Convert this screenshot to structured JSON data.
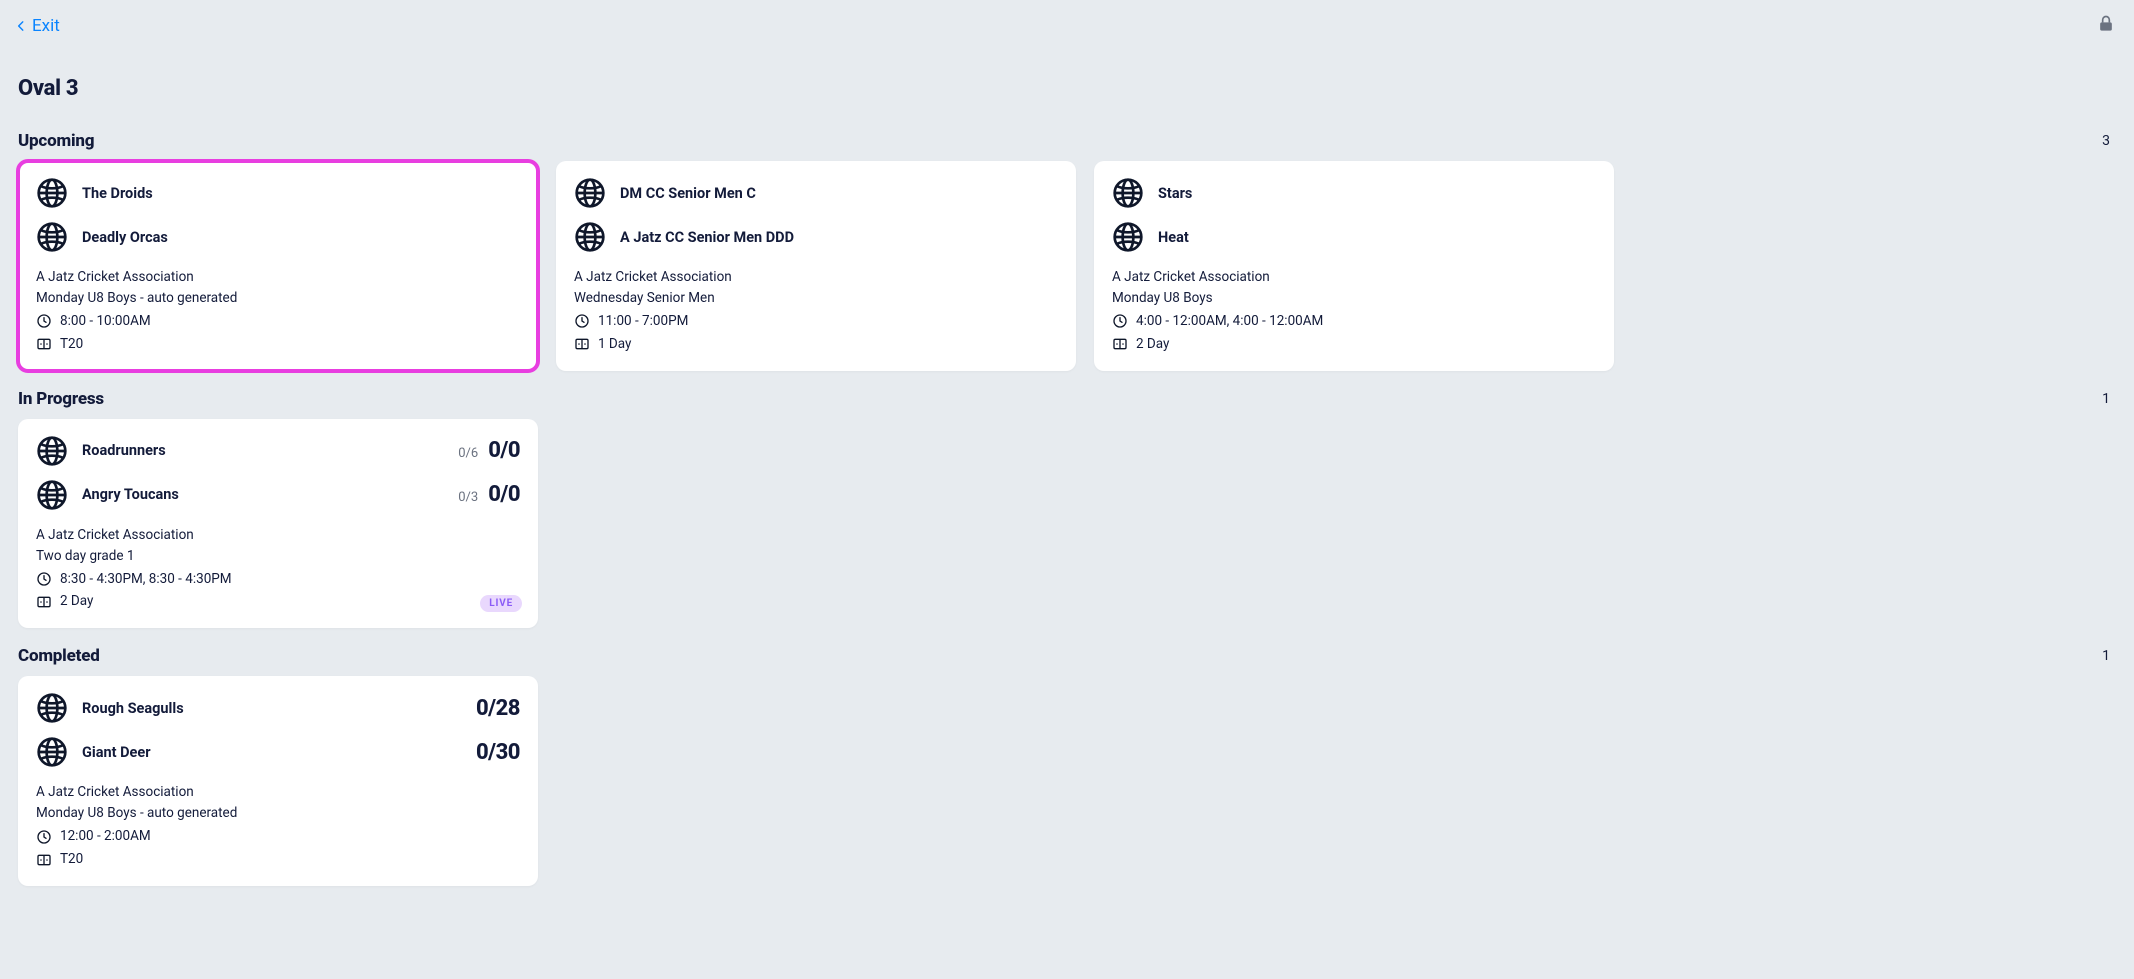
{
  "header": {
    "exit_label": "Exit",
    "page_title": "Oval 3"
  },
  "sections": {
    "upcoming": {
      "title": "Upcoming",
      "count": "3",
      "cards": [
        {
          "team1": "The Droids",
          "team2": "Deadly Orcas",
          "association": "A Jatz Cricket Association",
          "grade": "Monday U8 Boys - auto generated",
          "time": "8:00 - 10:00AM",
          "format": "T20"
        },
        {
          "team1": "DM CC Senior Men C",
          "team2": "A Jatz CC Senior Men DDD",
          "association": "A Jatz Cricket Association",
          "grade": "Wednesday Senior Men",
          "time": "11:00 - 7:00PM",
          "format": "1 Day"
        },
        {
          "team1": "Stars",
          "team2": "Heat",
          "association": "A Jatz Cricket Association",
          "grade": "Monday U8 Boys",
          "time": "4:00 - 12:00AM, 4:00 - 12:00AM",
          "format": "2 Day"
        }
      ]
    },
    "in_progress": {
      "title": "In Progress",
      "count": "1",
      "cards": [
        {
          "team1": "Roadrunners",
          "team1_overs": "0/6",
          "team1_score": "0/0",
          "team2": "Angry Toucans",
          "team2_overs": "0/3",
          "team2_score": "0/0",
          "association": "A Jatz Cricket Association",
          "grade": "Two day grade 1",
          "time": "8:30 - 4:30PM, 8:30 - 4:30PM",
          "format": "2 Day",
          "live_label": "LIVE"
        }
      ]
    },
    "completed": {
      "title": "Completed",
      "count": "1",
      "cards": [
        {
          "team1": "Rough Seagulls",
          "team1_score": "0/28",
          "team2": "Giant Deer",
          "team2_score": "0/30",
          "association": "A Jatz Cricket Association",
          "grade": "Monday U8 Boys - auto generated",
          "time": "12:00 - 2:00AM",
          "format": "T20"
        }
      ]
    }
  }
}
